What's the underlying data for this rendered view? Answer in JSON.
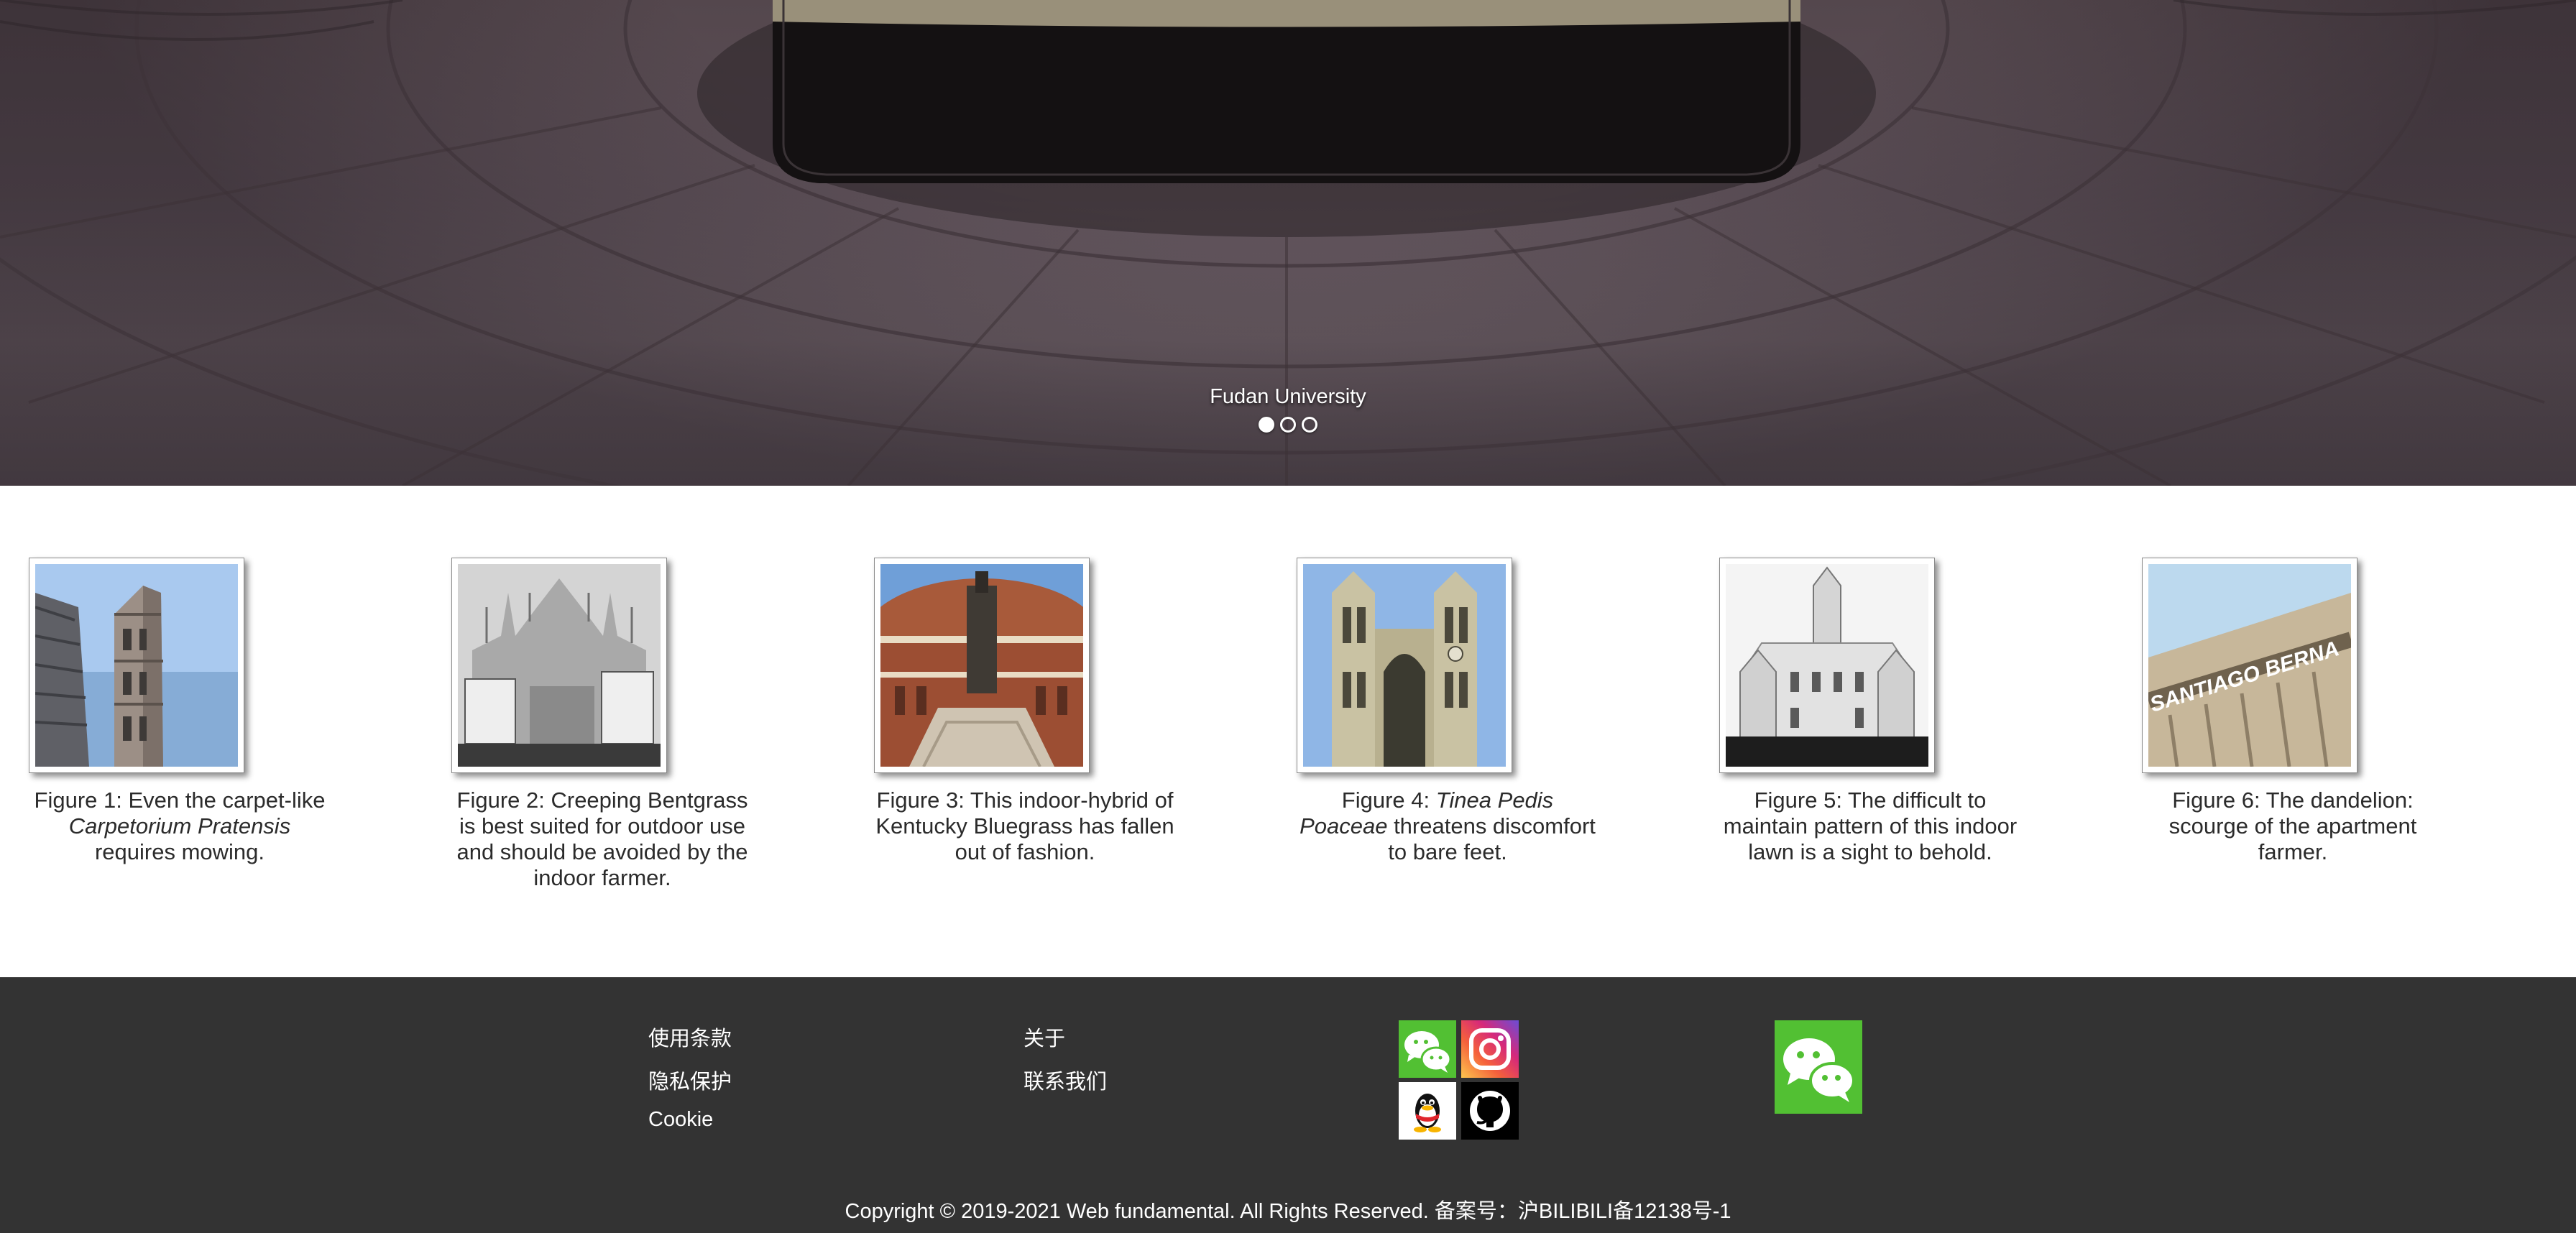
{
  "carousel": {
    "caption": "Fudan University",
    "slide_count": 3,
    "active_index": 0
  },
  "figures": [
    {
      "image": "florence-cathedral-bell-tower",
      "caption_parts": [
        "Figure 1: Even the carpet-like ",
        "Carpetorium Pratensis",
        " requires mowing."
      ]
    },
    {
      "image": "milan-cathedral-black-and-white",
      "caption_parts": [
        "Figure 2: Creeping Bentgrass is best suited for outdoor use and should be avoided by the indoor farmer.",
        "",
        ""
      ]
    },
    {
      "image": "royal-albert-hall",
      "caption_parts": [
        "Figure 3: This indoor-hybrid of Kentucky Bluegrass has fallen out of fashion.",
        "",
        ""
      ]
    },
    {
      "image": "westminster-abbey",
      "caption_parts": [
        "Figure 4: ",
        "Tinea Pedis Poaceae",
        " threatens discomfort to bare feet."
      ]
    },
    {
      "image": "cibeles-palace",
      "caption_parts": [
        "Figure 5: The difficult to maintain pattern of this indoor lawn is a sight to behold.",
        "",
        ""
      ]
    },
    {
      "image": "santiago-bernabeu-stadium",
      "image_text": "SANTIAGO BERNA",
      "caption_parts": [
        "Figure 6: The dandelion: scourge of the apartment farmer.",
        "",
        ""
      ]
    }
  ],
  "footer": {
    "links_col1": [
      "使用条款",
      "隐私保护",
      "Cookie"
    ],
    "links_col2": [
      "关于",
      "联系我们"
    ],
    "social_icons": [
      "wechat-icon",
      "instagram-icon",
      "qq-icon",
      "github-icon"
    ],
    "large_icon": "wechat-qr-icon",
    "copyright": "Copyright © 2019-2021 Web fundamental. All Rights Reserved. 备案号：沪BILIBILI备12138号-1"
  },
  "colors": {
    "footer_bg": "#333333",
    "wechat_green": "#52c033",
    "caption_text": "#2b2b2b"
  }
}
